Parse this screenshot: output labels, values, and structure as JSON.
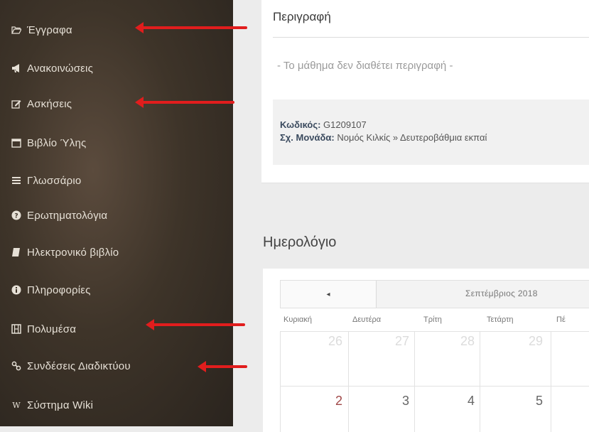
{
  "sidebar": {
    "items": [
      {
        "label": "Έγγραφα",
        "icon": "folder-open-icon"
      },
      {
        "label": "Ανακοινώσεις",
        "icon": "bullhorn-icon"
      },
      {
        "label": "Ασκήσεις",
        "icon": "edit-icon"
      },
      {
        "label": "Βιβλίο Ύλης",
        "icon": "calendar-icon"
      },
      {
        "label": "Γλωσσάριο",
        "icon": "list-icon"
      },
      {
        "label": "Ερωτηματολόγια",
        "icon": "question-circle-icon"
      },
      {
        "label": "Ηλεκτρονικό βιβλίο",
        "icon": "book-icon"
      },
      {
        "label": "Πληροφορίες",
        "icon": "info-circle-icon"
      },
      {
        "label": "Πολυμέσα",
        "icon": "film-icon"
      },
      {
        "label": "Συνδέσεις Διαδικτύου",
        "icon": "link-icon"
      },
      {
        "label": "Σύστημα Wiki",
        "icon": "wikipedia-icon"
      }
    ]
  },
  "description": {
    "title": "Περιγραφή",
    "empty_text": "- Το μάθημα δεν διαθέτει περιγραφή -",
    "code_label": "Κωδικός:",
    "code_value": "G1209107",
    "unit_label": "Σχ. Μονάδα:",
    "unit_value": "Νομός Κιλκίς » Δευτεροβάθμια εκπαί"
  },
  "calendar": {
    "title": "Ημερολόγιο",
    "prev_icon": "◂",
    "month": "Σεπτέμβριος 2018",
    "weekdays": [
      "Κυριακή",
      "Δευτέρα",
      "Τρίτη",
      "Τετάρτη",
      "Πέ"
    ],
    "row1": [
      "26",
      "27",
      "28",
      "29"
    ],
    "row2": [
      "2",
      "3",
      "4",
      "5"
    ]
  },
  "colors": {
    "arrow": "#e11d1d",
    "sidebar_text": "#e6e0d6",
    "sunday": "#a04848"
  }
}
